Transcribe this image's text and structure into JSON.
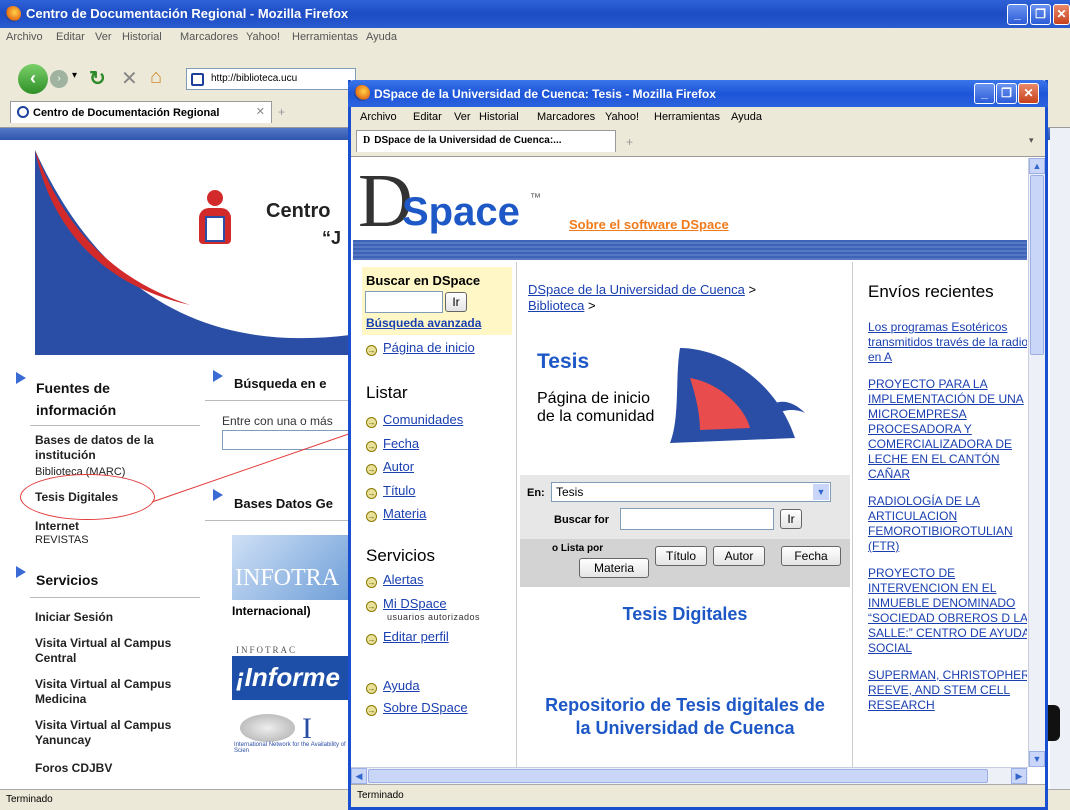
{
  "back_window": {
    "title": "Centro de Documentación Regional - Mozilla Firefox",
    "menu": [
      "Archivo",
      "Editar",
      "Ver",
      "Historial",
      "Marcadores",
      "Yahoo!",
      "Herramientas",
      "Ayuda"
    ],
    "url": "http://biblioteca.ucu",
    "tab_label": "Centro de Documentación Regional",
    "banner_text_1": "Centro",
    "banner_text_2": "“J",
    "sections": {
      "fuentes": "Fuentes de información",
      "busqueda": "Búsqueda en e",
      "busqueda_hint": "Entre con una o más",
      "bases_datos": "Bases Datos Ge",
      "servicios": "Servicios"
    },
    "nav_items": [
      "Bases de datos de la institución",
      "Biblioteca (MARC)",
      "Tesis Digitales",
      "Internet",
      "REVISTAS"
    ],
    "servicios_items": [
      "Iniciar Sesión",
      "Visita Virtual al Campus Central",
      "Visita Virtual al Campus Medicina",
      "Visita Virtual al Campus Yanuncay",
      "Foros CDJBV"
    ],
    "infotrac": "INFOTRA",
    "internacional": "Internacional)",
    "infotrac_small": "INFOTRAC",
    "informe": "¡Informe",
    "inasp": "International Network for the Availability of Scien",
    "status": "Terminado"
  },
  "front_window": {
    "title": "DSpace de la Universidad de Cuenca: Tesis - Mozilla Firefox",
    "menu": [
      "Archivo",
      "Editar",
      "Ver",
      "Historial",
      "Marcadores",
      "Yahoo!",
      "Herramientas",
      "Ayuda"
    ],
    "tab_label": "DSpace de la Universidad de Cuenca:...",
    "logo_d": "D",
    "logo_space": "Space",
    "logo_tm": "™",
    "about_link": "Sobre el software DSpace",
    "search_box_title": "Buscar en DSpace",
    "go": "Ir",
    "advanced": "Búsqueda avanzada",
    "home": "Página de inicio",
    "listar": "Listar",
    "listar_items": [
      "Comunidades",
      "Fecha",
      "Autor",
      "Título",
      "Materia"
    ],
    "servicios": "Servicios",
    "alertas": "Alertas",
    "mi_dspace": "Mi DSpace",
    "mi_dspace_sub": "usuarios autorizados",
    "editar_perfil": "Editar perfil",
    "ayuda": "Ayuda",
    "sobre": "Sobre DSpace",
    "breadcrumb_1": "DSpace de la Universidad de Cuenca",
    "breadcrumb_sep": ">",
    "breadcrumb_2": "Biblioteca",
    "heading": "Tesis",
    "community_text": "Página de inicio de la comunidad",
    "en_label": "En:",
    "en_value": "Tesis",
    "buscar_for": "Buscar for",
    "lista_por": "o Lista por",
    "btn_titulo": "Título",
    "btn_autor": "Autor",
    "btn_fecha": "Fecha",
    "btn_materia": "Materia",
    "tesis_digitales": "Tesis Digitales",
    "repositorio": "Repositorio de Tesis digitales de la Universidad de Cuenca",
    "recent_title": "Envíos recientes",
    "recent_items": [
      "Los programas Esotéricos transmitidos través de la radio en A",
      "PROYECTO PARA LA IMPLEMENTACIÓN DE UNA MICROEMPRESA PROCESADORA Y COMERCIALIZADORA DE LECHE EN EL CANTÓN CAÑAR",
      "RADIOLOGÍA DE LA ARTICULACION FEMOROTIBIOROTULIAN (FTR)",
      "PROYECTO DE INTERVENCION EN EL INMUEBLE DENOMINADO “SOCIEDAD OBREROS D LA SALLE:” CENTRO DE AYUDA SOCIAL",
      "SUPERMAN, CHRISTOPHER REEVE, AND STEM CELL RESEARCH"
    ],
    "status": "Terminado"
  }
}
